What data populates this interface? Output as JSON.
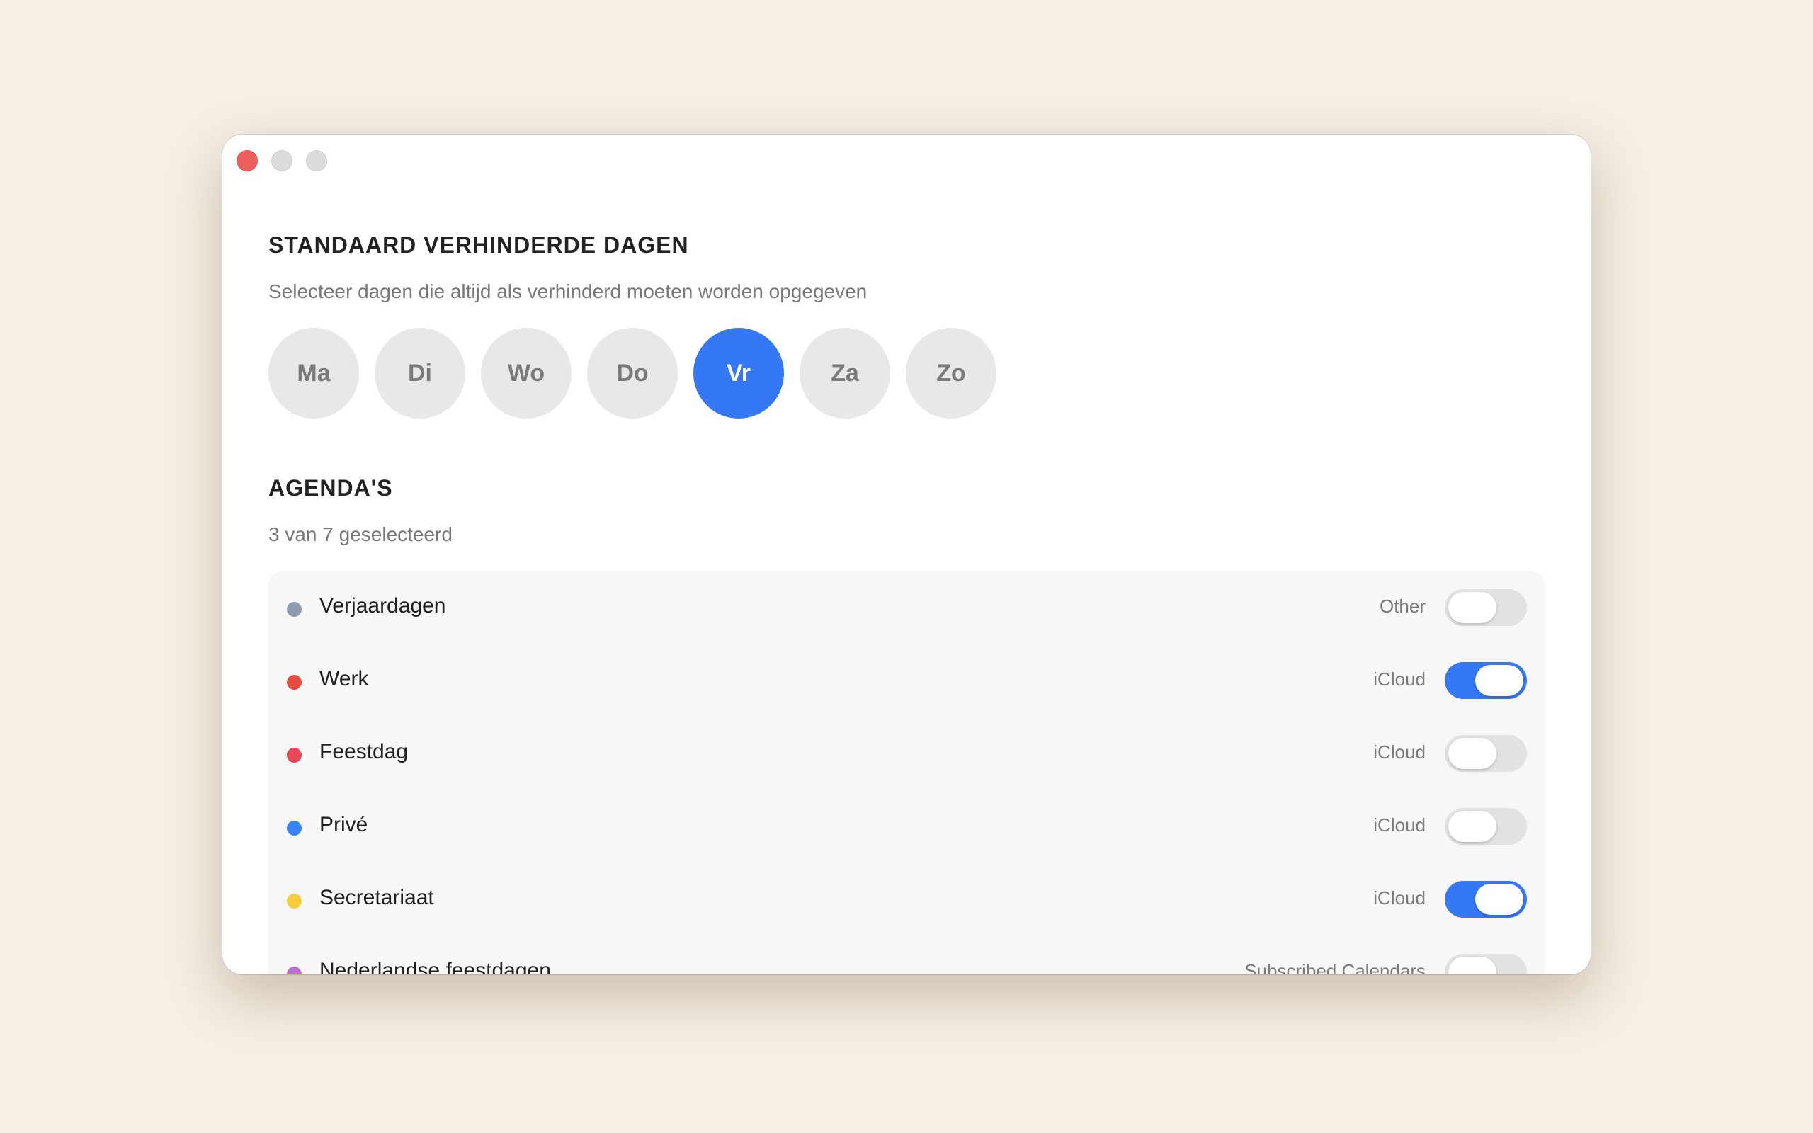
{
  "days_section": {
    "title": "STANDAARD VERHINDERDE DAGEN",
    "subtitle": "Selecteer dagen die altijd als verhinderd moeten worden opgegeven",
    "days": [
      {
        "label": "Ma",
        "selected": false
      },
      {
        "label": "Di",
        "selected": false
      },
      {
        "label": "Wo",
        "selected": false
      },
      {
        "label": "Do",
        "selected": false
      },
      {
        "label": "Vr",
        "selected": true
      },
      {
        "label": "Za",
        "selected": false
      },
      {
        "label": "Zo",
        "selected": false
      }
    ]
  },
  "calendars_section": {
    "title": "AGENDA'S",
    "count_text": "3 van 7 geselecteerd",
    "items": [
      {
        "name": "Verjaardagen",
        "source": "Other",
        "enabled": false,
        "color": "#8e9bb0"
      },
      {
        "name": "Werk",
        "source": "iCloud",
        "enabled": true,
        "color": "#e64a40"
      },
      {
        "name": "Feestdag",
        "source": "iCloud",
        "enabled": false,
        "color": "#ea4656"
      },
      {
        "name": "Privé",
        "source": "iCloud",
        "enabled": false,
        "color": "#3a82f7"
      },
      {
        "name": "Secretariaat",
        "source": "iCloud",
        "enabled": true,
        "color": "#f7cd3e"
      },
      {
        "name": "Nederlandse feestdagen",
        "source": "Subscribed Calendars",
        "enabled": false,
        "color": "#bd6ed8"
      }
    ]
  },
  "colors": {
    "accent": "#3478f6",
    "close_button": "#ed5f5c",
    "background": "#f6efe4"
  }
}
